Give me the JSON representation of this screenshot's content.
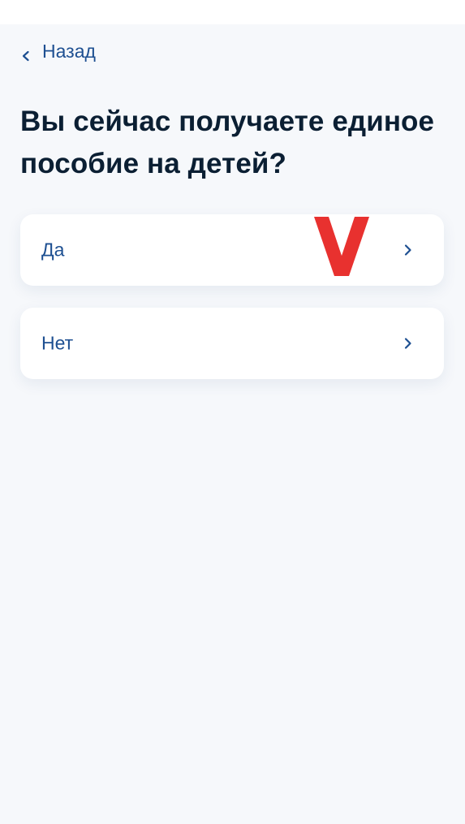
{
  "nav": {
    "back_label": "Назад"
  },
  "question": {
    "title": "Вы сейчас получаете единое пособие на детей?"
  },
  "options": [
    {
      "label": "Да",
      "selected": true
    },
    {
      "label": "Нет",
      "selected": false
    }
  ],
  "colors": {
    "background": "#f6f8fb",
    "accent": "#1d4f91",
    "title": "#0b1f33",
    "mark": "#e8312f"
  },
  "icons": {
    "back": "chevron-left-icon",
    "option": "chevron-right-icon",
    "mark": "red-v-checkmark-icon"
  }
}
